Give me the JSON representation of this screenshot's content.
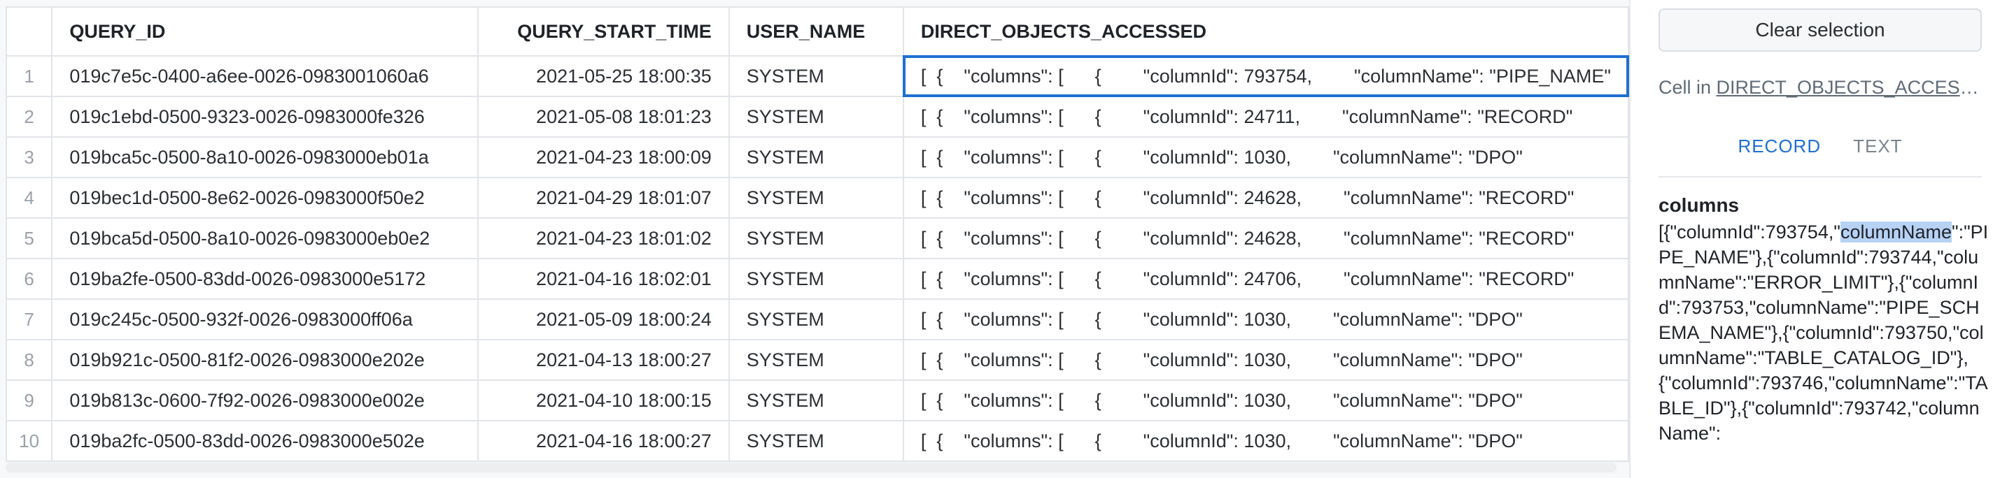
{
  "grid": {
    "columns": [
      {
        "key": "rownum",
        "label": ""
      },
      {
        "key": "query_id",
        "label": "QUERY_ID"
      },
      {
        "key": "start_time",
        "label": "QUERY_START_TIME"
      },
      {
        "key": "user_name",
        "label": "USER_NAME"
      },
      {
        "key": "objects",
        "label": "DIRECT_OBJECTS_ACCESSED"
      }
    ],
    "rows": [
      {
        "rownum": "1",
        "query_id": "019c7e5c-0400-a6ee-0026-0983001060a6",
        "start_time": "2021-05-25 18:00:35",
        "user_name": "SYSTEM",
        "objects": "[  {    \"columns\": [      {        \"columnId\": 793754,        \"columnName\": \"PIPE_NAME\""
      },
      {
        "rownum": "2",
        "query_id": "019c1ebd-0500-9323-0026-0983000fe326",
        "start_time": "2021-05-08 18:01:23",
        "user_name": "SYSTEM",
        "objects": "[  {    \"columns\": [      {        \"columnId\": 24711,        \"columnName\": \"RECORD\""
      },
      {
        "rownum": "3",
        "query_id": "019bca5c-0500-8a10-0026-0983000eb01a",
        "start_time": "2021-04-23 18:00:09",
        "user_name": "SYSTEM",
        "objects": "[  {    \"columns\": [      {        \"columnId\": 1030,        \"columnName\": \"DPO\""
      },
      {
        "rownum": "4",
        "query_id": "019bec1d-0500-8e62-0026-0983000f50e2",
        "start_time": "2021-04-29 18:01:07",
        "user_name": "SYSTEM",
        "objects": "[  {    \"columns\": [      {        \"columnId\": 24628,        \"columnName\": \"RECORD\""
      },
      {
        "rownum": "5",
        "query_id": "019bca5d-0500-8a10-0026-0983000eb0e2",
        "start_time": "2021-04-23 18:01:02",
        "user_name": "SYSTEM",
        "objects": "[  {    \"columns\": [      {        \"columnId\": 24628,        \"columnName\": \"RECORD\""
      },
      {
        "rownum": "6",
        "query_id": "019ba2fe-0500-83dd-0026-0983000e5172",
        "start_time": "2021-04-16 18:02:01",
        "user_name": "SYSTEM",
        "objects": "[  {    \"columns\": [      {        \"columnId\": 24706,        \"columnName\": \"RECORD\""
      },
      {
        "rownum": "7",
        "query_id": "019c245c-0500-932f-0026-0983000ff06a",
        "start_time": "2021-05-09 18:00:24",
        "user_name": "SYSTEM",
        "objects": "[  {    \"columns\": [      {        \"columnId\": 1030,        \"columnName\": \"DPO\""
      },
      {
        "rownum": "8",
        "query_id": "019b921c-0500-81f2-0026-0983000e202e",
        "start_time": "2021-04-13 18:00:27",
        "user_name": "SYSTEM",
        "objects": "[  {    \"columns\": [      {        \"columnId\": 1030,        \"columnName\": \"DPO\""
      },
      {
        "rownum": "9",
        "query_id": "019b813c-0600-7f92-0026-0983000e002e",
        "start_time": "2021-04-10 18:00:15",
        "user_name": "SYSTEM",
        "objects": "[  {    \"columns\": [      {        \"columnId\": 1030,        \"columnName\": \"DPO\""
      },
      {
        "rownum": "10",
        "query_id": "019ba2fc-0500-83dd-0026-0983000e502e",
        "start_time": "2021-04-16 18:00:27",
        "user_name": "SYSTEM",
        "objects": "[  {    \"columns\": [      {        \"columnId\": 1030,        \"columnName\": \"DPO\""
      }
    ]
  },
  "panel": {
    "clear_label": "Clear selection",
    "cell_prefix": "Cell in ",
    "cell_column": "DIRECT_OBJECTS_ACCESSED",
    "tabs": [
      {
        "label": "RECORD",
        "active": true
      },
      {
        "label": "TEXT",
        "active": false
      }
    ],
    "record": {
      "field_name": "columns",
      "value_before": "[{\"columnId\":793754,\"",
      "value_highlight": "columnName",
      "value_after": "\":\"PIPE_NAME\"},{\"columnId\":793744,\"columnName\":\"ERROR_LIMIT\"},{\"columnId\":793753,\"columnName\":\"PIPE_SCHEMA_NAME\"},{\"columnId\":793750,\"columnName\":\"TABLE_CATALOG_ID\"},{\"columnId\":793746,\"columnName\":\"TABLE_ID\"},{\"columnId\":793742,\"columnName\":"
    }
  },
  "colors": {
    "accent": "#1f6fd1",
    "highlight": "#b7d2f5"
  }
}
